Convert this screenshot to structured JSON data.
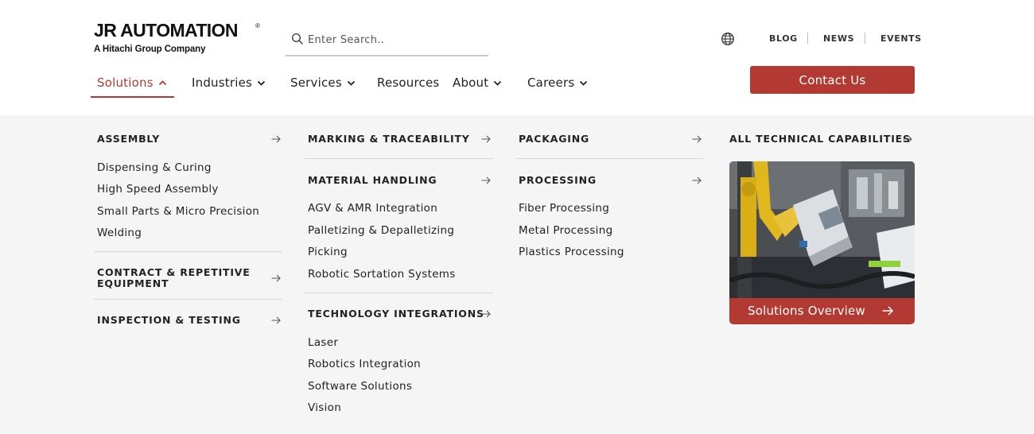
{
  "brand": {
    "name": "JR AUTOMATION",
    "registered": "®",
    "tagline": "A Hitachi Group Company"
  },
  "search": {
    "placeholder": "Enter Search.."
  },
  "utility_nav": {
    "blog": "BLOG",
    "news": "NEWS",
    "events": "EVENTS"
  },
  "main_nav": {
    "solutions": "Solutions",
    "industries": "Industries",
    "services": "Services",
    "resources": "Resources",
    "about": "About",
    "careers": "Careers",
    "contact": "Contact Us"
  },
  "menu": {
    "col1": {
      "assembly": "ASSEMBLY",
      "assembly_links": [
        "Dispensing & Curing",
        "High Speed Assembly",
        "Small Parts & Micro Precision",
        "Welding"
      ],
      "contract_line1": "CONTRACT & REPETITIVE",
      "contract_line2": "EQUIPMENT",
      "inspection": "INSPECTION & TESTING"
    },
    "col2": {
      "marking": "MARKING & TRACEABILITY",
      "material": "MATERIAL HANDLING",
      "material_links": [
        "AGV & AMR Integration",
        "Palletizing & Depalletizing",
        "Picking",
        "Robotic Sortation Systems"
      ],
      "technology": "TECHNOLOGY INTEGRATIONS",
      "technology_links": [
        "Laser",
        "Robotics Integration",
        "Software Solutions",
        "Vision"
      ]
    },
    "col3": {
      "packaging": "PACKAGING",
      "processing": "PROCESSING",
      "processing_links": [
        "Fiber Processing",
        "Metal Processing",
        "Plastics Processing"
      ]
    },
    "col4": {
      "all": "ALL TECHNICAL CAPABILITIES",
      "card_label": "Solutions Overview"
    }
  },
  "colors": {
    "accent": "#b23a33",
    "panel_bg": "#f5f5f5",
    "header_bg": "#ffffff"
  },
  "icons": [
    "search-icon",
    "globe-icon",
    "chevron-up-icon",
    "chevron-down-icon",
    "arrow-right-icon"
  ]
}
